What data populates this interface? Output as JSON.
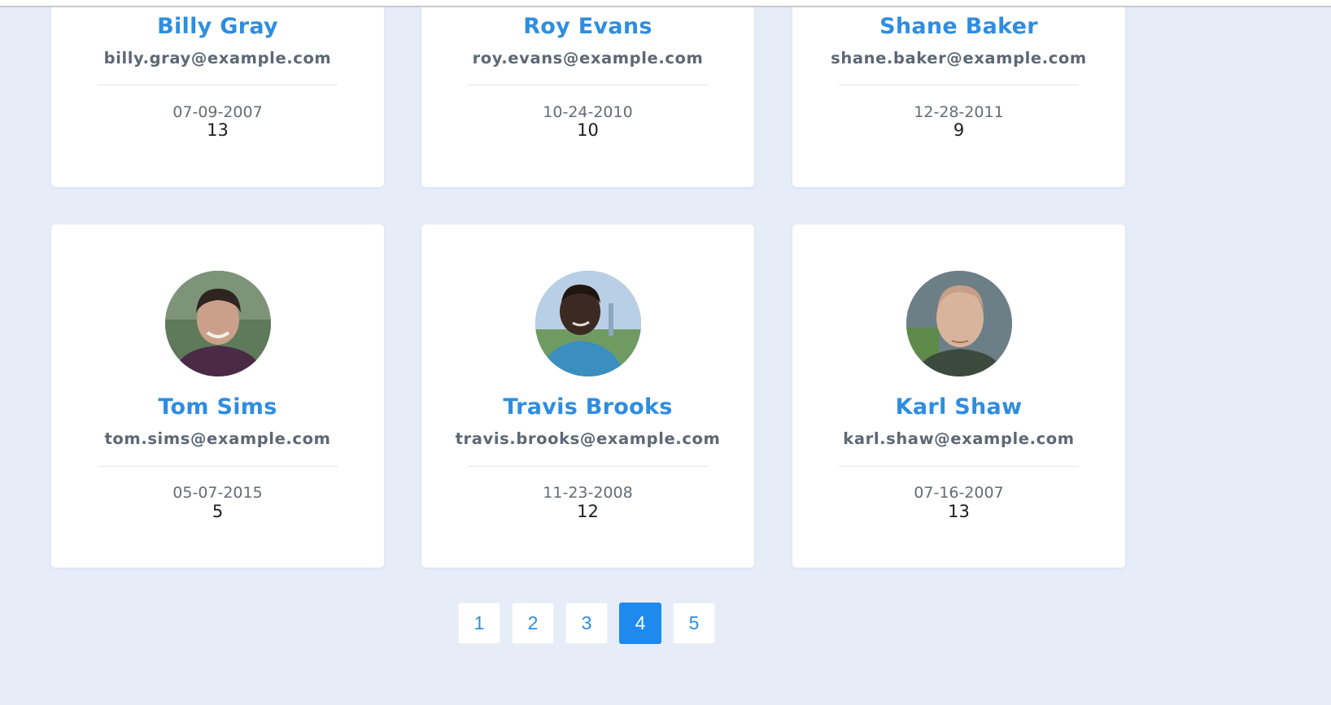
{
  "cards_top": [
    {
      "name": "Billy Gray",
      "email": "billy.gray@example.com",
      "date": "07-09-2007",
      "count": "13"
    },
    {
      "name": "Roy Evans",
      "email": "roy.evans@example.com",
      "date": "10-24-2010",
      "count": "10"
    },
    {
      "name": "Shane Baker",
      "email": "shane.baker@example.com",
      "date": "12-28-2011",
      "count": "9"
    }
  ],
  "cards_bottom": [
    {
      "name": "Tom Sims",
      "email": "tom.sims@example.com",
      "date": "05-07-2015",
      "count": "5"
    },
    {
      "name": "Travis Brooks",
      "email": "travis.brooks@example.com",
      "date": "11-23-2008",
      "count": "12"
    },
    {
      "name": "Karl Shaw",
      "email": "karl.shaw@example.com",
      "date": "07-16-2007",
      "count": "13"
    }
  ],
  "pagination": {
    "pages": [
      "1",
      "2",
      "3",
      "4",
      "5"
    ],
    "current": "4"
  },
  "colors": {
    "background": "#e6edf9",
    "accent": "#2e8de0",
    "active_page": "#1e8af0",
    "card": "#ffffff"
  }
}
